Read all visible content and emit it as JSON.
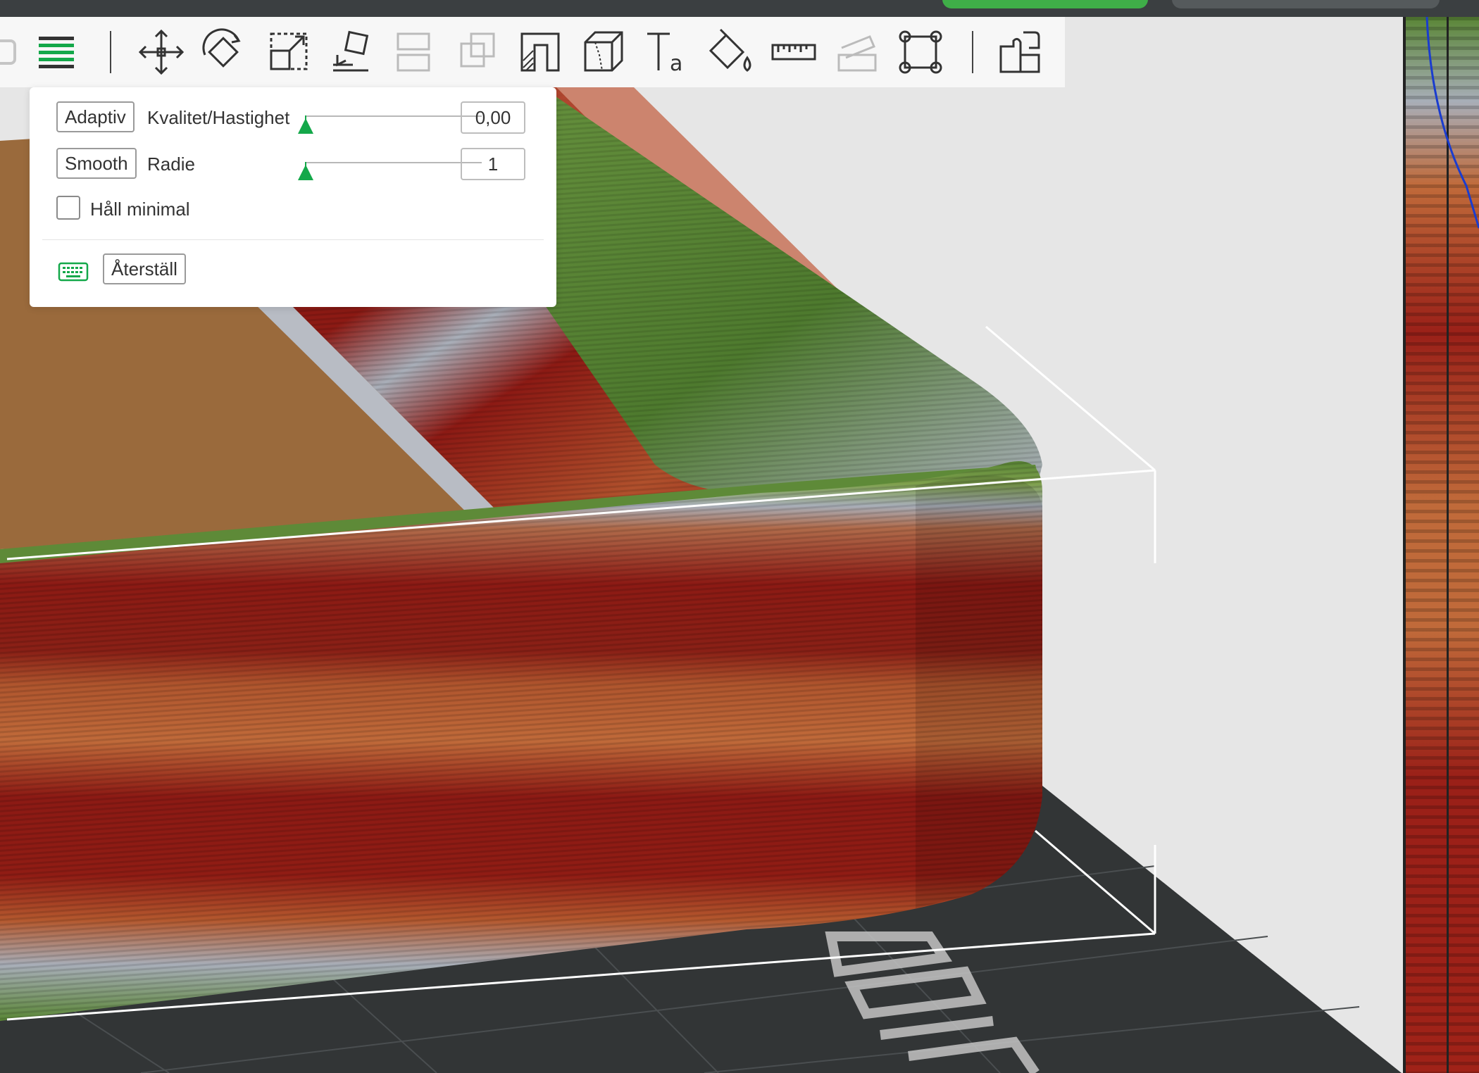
{
  "colors": {
    "accent": "#14a84a",
    "panel_bg": "#ffffff",
    "toolbar_bg": "#f8f8f8",
    "bed": "#323536",
    "band_green": "#5a8636",
    "band_red": "#8c1a14",
    "band_orange": "#b0502c",
    "band_grey": "#a8aeb8",
    "inner_floor": "#9a6a3c"
  },
  "toolbar": {
    "items": [
      {
        "icon": "layers-icon",
        "enabled": true
      },
      {
        "icon": "move-icon",
        "enabled": true
      },
      {
        "icon": "rotate-icon",
        "enabled": true
      },
      {
        "icon": "scale-icon",
        "enabled": true
      },
      {
        "icon": "lay-on-face-icon",
        "enabled": true
      },
      {
        "icon": "arrange-icon",
        "enabled": false
      },
      {
        "icon": "copy-icon",
        "enabled": false
      },
      {
        "icon": "support-paint-icon",
        "enabled": true
      },
      {
        "icon": "seam-paint-icon",
        "enabled": true
      },
      {
        "icon": "text-icon",
        "enabled": true
      },
      {
        "icon": "color-paint-icon",
        "enabled": true
      },
      {
        "icon": "measure-icon",
        "enabled": true
      },
      {
        "icon": "cut-icon",
        "enabled": false
      },
      {
        "icon": "assembly-icon",
        "enabled": true
      },
      {
        "icon": "plate-split-icon",
        "enabled": true
      }
    ]
  },
  "panel": {
    "adaptive_button": "Adaptiv",
    "quality_label": "Kvalitet/Hastighet",
    "quality_value": "0,00",
    "quality_level": 0.0,
    "smooth_button": "Smooth",
    "radius_label": "Radie",
    "radius_value": "1",
    "radius_level": 0.0,
    "keep_min_label": "Håll minimal",
    "keep_min_checked": false,
    "reset_button": "Återställ",
    "keyboard_icon": "keyboard-icon"
  }
}
